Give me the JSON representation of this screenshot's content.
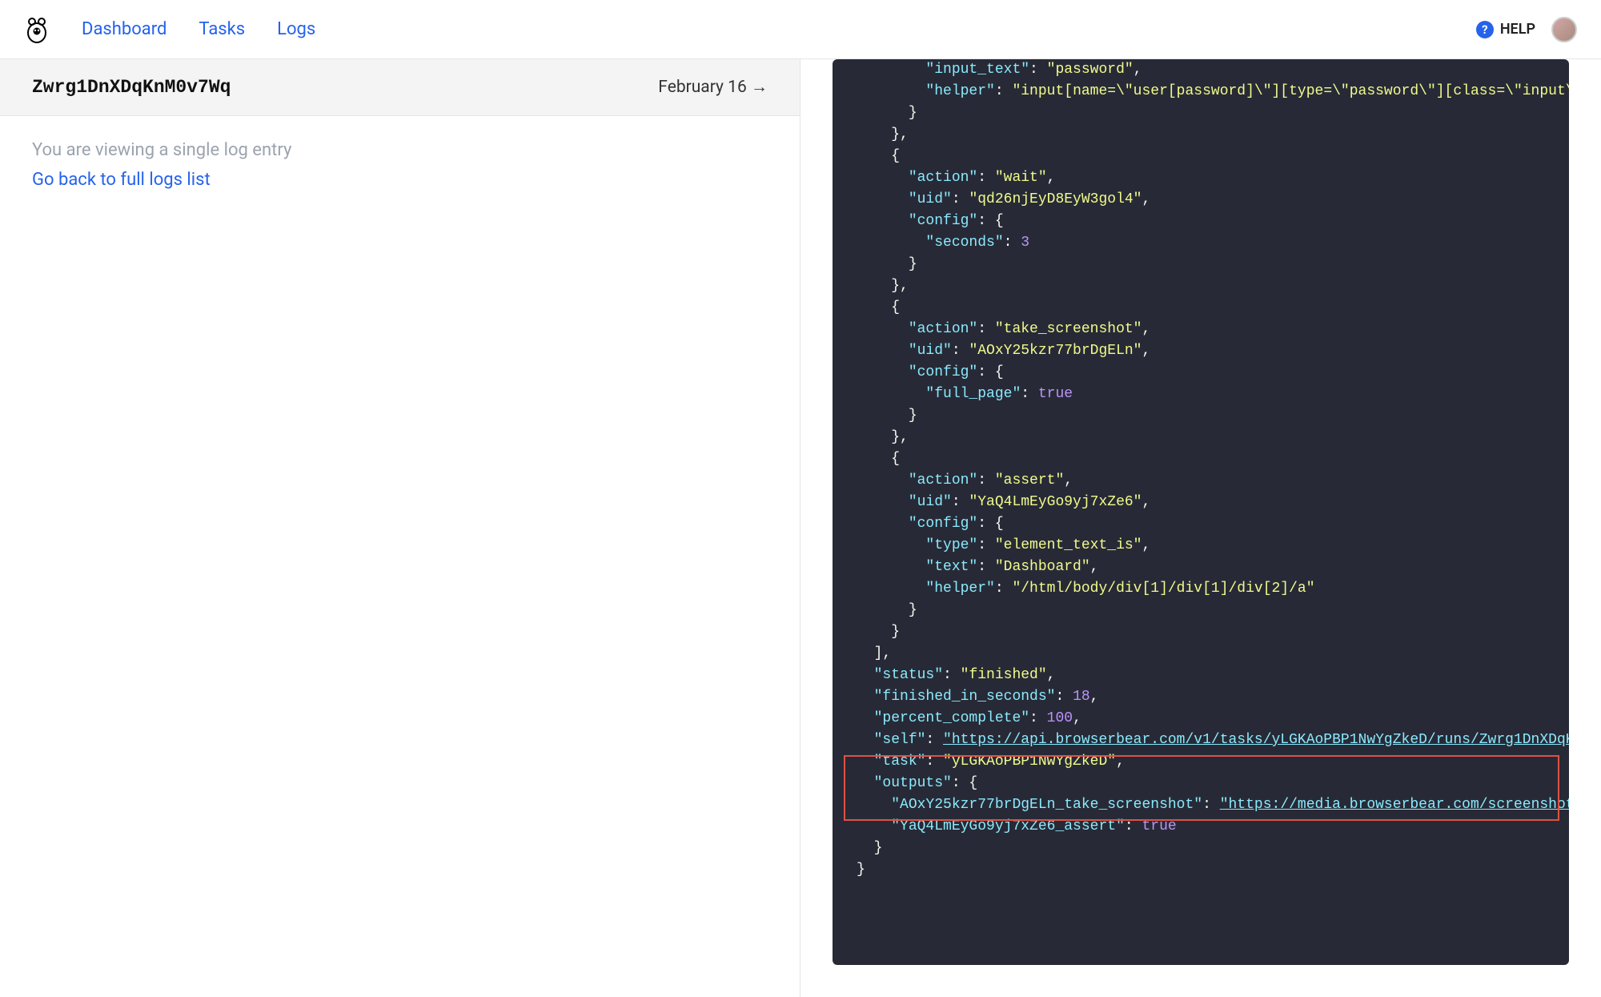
{
  "nav": {
    "dashboard": "Dashboard",
    "tasks": "Tasks",
    "logs": "Logs",
    "help": "HELP"
  },
  "log": {
    "id": "Zwrg1DnXDqKnM0v7Wq",
    "date": "February 16 →",
    "info": "You are viewing a single log entry",
    "back": "Go back to full logs list"
  },
  "code": {
    "input_text_key": "\"input_text\"",
    "input_text_val": "\"password\"",
    "helper1_key": "\"helper\"",
    "helper1_val": "\"input[name=\\\"user[password]\\\"][type=\\\"password\\\"][class=\\\"input\\",
    "action_key": "\"action\"",
    "wait_val": "\"wait\"",
    "uid_key": "\"uid\"",
    "uid_wait_val": "\"qd26njEyD8EyW3gol4\"",
    "config_key": "\"config\"",
    "seconds_key": "\"seconds\"",
    "seconds_val": "3",
    "screenshot_val": "\"take_screenshot\"",
    "uid_ss_val": "\"AOxY25kzr77brDgELn\"",
    "fullpage_key": "\"full_page\"",
    "true_val": "true",
    "assert_val": "\"assert\"",
    "uid_assert_val": "\"YaQ4LmEyGo9yj7xZe6\"",
    "type_key": "\"type\"",
    "type_val": "\"element_text_is\"",
    "text_key": "\"text\"",
    "text_val": "\"Dashboard\"",
    "helper2_val": "\"/html/body/div[1]/div[1]/div[2]/a\"",
    "status_key": "\"status\"",
    "status_val": "\"finished\"",
    "finished_key": "\"finished_in_seconds\"",
    "finished_val": "18",
    "percent_key": "\"percent_complete\"",
    "percent_val": "100",
    "self_key": "\"self\"",
    "self_val": "\"https://api.browserbear.com/v1/tasks/yLGKAoPBP1NwYgZkeD/runs/Zwrg1DnXDqK",
    "task_key": "\"task\"",
    "task_val": "\"yLGKAoPBP1NwYgZkeD\"",
    "outputs_key": "\"outputs\"",
    "out_ss_key": "\"AOxY25kzr77brDgELn_take_screenshot\"",
    "out_ss_val": "\"https://media.browserbear.com/screenshot",
    "out_assert_key": "\"YaQ4LmEyGo9yj7xZe6_assert\""
  }
}
